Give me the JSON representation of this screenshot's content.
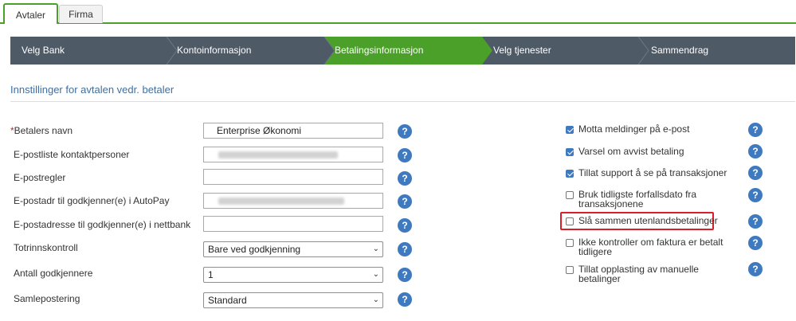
{
  "tabs": [
    {
      "label": "Avtaler",
      "active": true
    },
    {
      "label": "Firma",
      "active": false
    }
  ],
  "wizard": {
    "steps": [
      {
        "label": "Velg Bank",
        "state": "done"
      },
      {
        "label": "Kontoinformasjon",
        "state": "done"
      },
      {
        "label": "Betalingsinformasjon",
        "state": "active"
      },
      {
        "label": "Velg tjenester",
        "state": "todo"
      },
      {
        "label": "Sammendrag",
        "state": "todo"
      }
    ],
    "colors": {
      "default": "#4e5a66",
      "active": "#4aa028"
    }
  },
  "section": {
    "title": "Innstillinger for avtalen vedr. betaler"
  },
  "form": {
    "betalers_navn": {
      "required_mark": "*",
      "label": "Betalers navn",
      "value": "Enterprise Økonomi"
    },
    "epostliste": {
      "label": "E-postliste kontaktpersoner",
      "value_obscured": true
    },
    "epostregler": {
      "label": "E-postregler",
      "value": ""
    },
    "epostadr_autopay": {
      "label": "E-postadr til godkjenner(e) i AutoPay",
      "value_obscured": true
    },
    "epostadresse_nettbank": {
      "label": "E-postadresse til godkjenner(e) i nettbank",
      "value": ""
    },
    "totrinnskontroll": {
      "label": "Totrinnskontroll",
      "selected": "Bare ved godkjenning"
    },
    "antall_godkjennere": {
      "label": "Antall godkjennere",
      "selected": "1"
    },
    "samlepostering": {
      "label": "Samlepostering",
      "selected": "Standard"
    }
  },
  "options": [
    {
      "label": "Motta meldinger på e-post",
      "checked": true
    },
    {
      "label": "Varsel om avvist betaling",
      "checked": true
    },
    {
      "label": "Tillat support å se på transaksjoner",
      "checked": true
    },
    {
      "label": "Bruk tidligste forfallsdato fra transaksjonene",
      "checked": false
    },
    {
      "label": "Slå sammen utenlandsbetalinger",
      "checked": false,
      "highlighted": true
    },
    {
      "label": "Ikke kontroller om faktura er betalt tidligere",
      "checked": false
    },
    {
      "label": "Tillat opplasting av manuelle betalinger",
      "checked": false
    }
  ],
  "help": {
    "glyph": "?",
    "icon": "help-circle-icon",
    "color": "#3f7ac0"
  },
  "select_chevron": "⌄",
  "highlight_color": "#d9202a"
}
